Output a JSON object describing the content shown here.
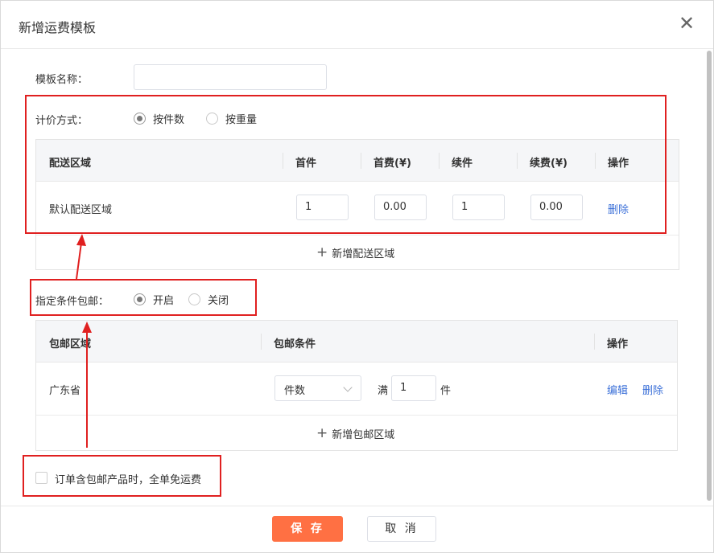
{
  "dialog": {
    "title": "新增运费模板",
    "close_glyph": "✕"
  },
  "form": {
    "name_label": "模板名称：",
    "name_value": "",
    "pricing_label": "计价方式：",
    "pricing_options": [
      "按件数",
      "按重量"
    ],
    "pricing_selected": "按件数"
  },
  "shipping_table": {
    "headers": [
      "配送区域",
      "首件",
      "首费(¥)",
      "续件",
      "续费(¥)",
      "操作"
    ],
    "rows": [
      {
        "region": "默认配送区域",
        "first": "1",
        "first_fee": "0.00",
        "additional": "1",
        "additional_fee": "0.00",
        "action": "删除"
      }
    ],
    "add_label": "新增配送区域"
  },
  "free_shipping": {
    "label": "指定条件包邮：",
    "options": [
      "开启",
      "关闭"
    ],
    "selected": "开启",
    "headers": [
      "包邮区域",
      "包邮条件",
      "操作"
    ],
    "rows": [
      {
        "region": "广东省",
        "condition_type": "件数",
        "prefix": "满",
        "value": "1",
        "unit": "件",
        "edit": "编辑",
        "delete": "删除"
      }
    ],
    "add_label": "新增包邮区域"
  },
  "checkbox_label": "订单含包邮产品时，全单免运费",
  "footer": {
    "save": "保 存",
    "cancel": "取 消"
  },
  "colors": {
    "primary": "#ff7043",
    "link": "#3a6fd8",
    "annotation": "#e02020"
  }
}
